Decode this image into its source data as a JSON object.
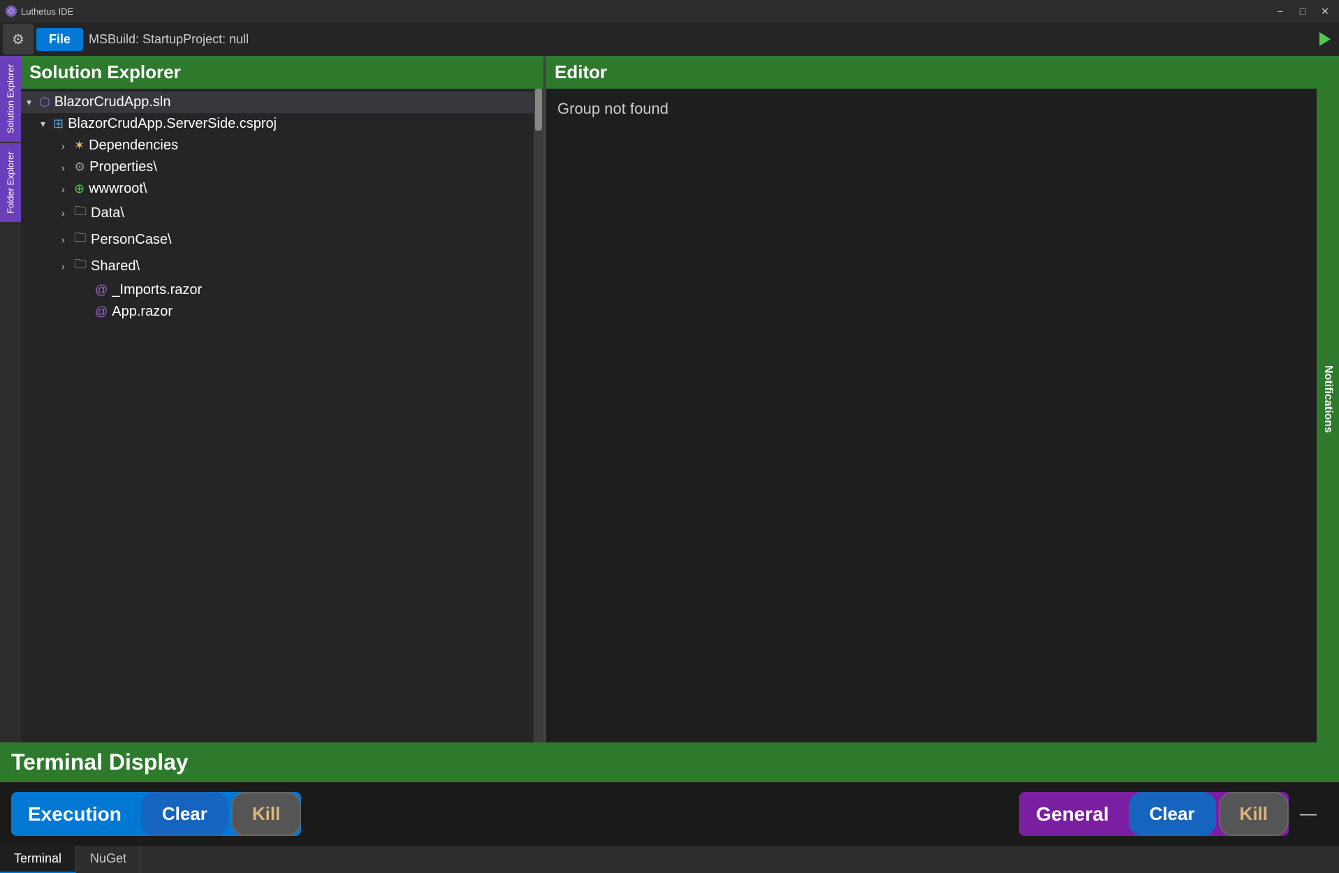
{
  "titleBar": {
    "appName": "Luthetus IDE",
    "minimizeLabel": "−",
    "maximizeLabel": "□",
    "closeLabel": "✕"
  },
  "menuBar": {
    "gearIcon": "⚙",
    "fileLabel": "File",
    "startupText": "MSBuild: StartupProject:  null",
    "runIcon": "▶"
  },
  "leftSidebar": {
    "tab1": "Solution Explorer",
    "tab2": "Folder Explorer"
  },
  "solutionExplorer": {
    "title": "Solution Explorer",
    "tree": [
      {
        "label": "BlazorCrudApp.sln",
        "indent": 0,
        "icon": "sln",
        "chevron": "▾",
        "iconChar": "⬡"
      },
      {
        "label": "BlazorCrudApp.ServerSide.csproj",
        "indent": 1,
        "icon": "csproj",
        "chevron": "▾",
        "iconChar": "⊞"
      },
      {
        "label": "Dependencies",
        "indent": 2,
        "icon": "deps",
        "chevron": "›",
        "iconChar": "✶"
      },
      {
        "label": "Properties\\",
        "indent": 2,
        "icon": "props",
        "chevron": "›",
        "iconChar": "⚙"
      },
      {
        "label": "wwwroot\\",
        "indent": 2,
        "icon": "web",
        "chevron": "›",
        "iconChar": "⊕"
      },
      {
        "label": "Data\\",
        "indent": 2,
        "icon": "folder",
        "chevron": "›",
        "iconChar": "📁"
      },
      {
        "label": "PersonCase\\",
        "indent": 2,
        "icon": "folder",
        "chevron": "›",
        "iconChar": "📁"
      },
      {
        "label": "Shared\\",
        "indent": 2,
        "icon": "folder",
        "chevron": "›",
        "iconChar": "📁"
      },
      {
        "label": "_Imports.razor",
        "indent": 3,
        "icon": "razor",
        "chevron": "",
        "iconChar": "@"
      },
      {
        "label": "App.razor",
        "indent": 3,
        "icon": "razor",
        "chevron": "",
        "iconChar": "@"
      }
    ]
  },
  "editor": {
    "title": "Editor",
    "content": "Group not found"
  },
  "rightSidebar": {
    "notificationsLabel": "Notifications"
  },
  "terminalDisplay": {
    "title": "Terminal Display",
    "executionLabel": "Execution",
    "clearLabel": "Clear",
    "killLabel": "Kill",
    "generalLabel": "General",
    "clearLabel2": "Clear",
    "killLabel2": "Kill",
    "dashChar": "—"
  },
  "terminalTabs": {
    "tab1": "Terminal",
    "tab2": "NuGet"
  }
}
